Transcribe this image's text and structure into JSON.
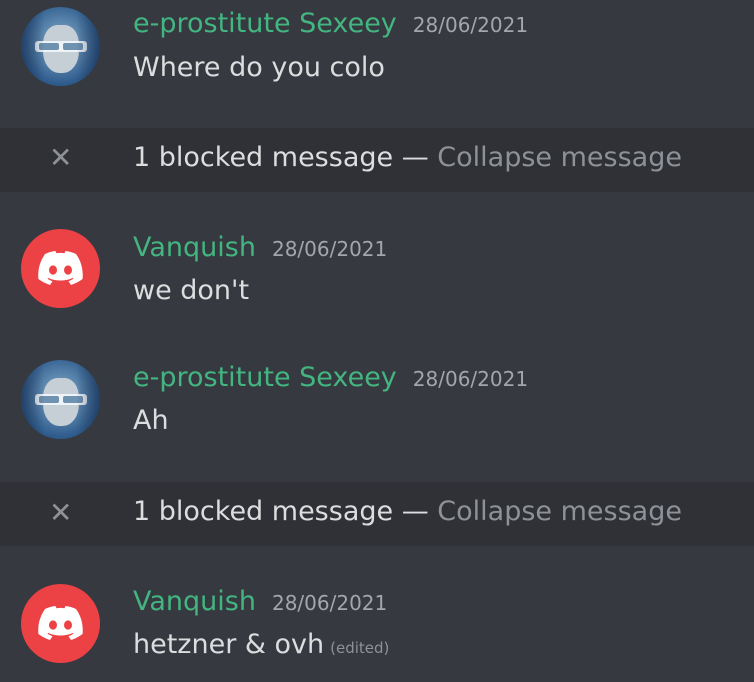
{
  "messages": [
    {
      "username": "e-prostitute Sexeey",
      "timestamp": "28/06/2021",
      "content": "Where do you colo"
    },
    {
      "username": "Vanquish",
      "timestamp": "28/06/2021",
      "content": "we don't"
    },
    {
      "username": "e-prostitute Sexeey",
      "timestamp": "28/06/2021",
      "content": "Ah"
    },
    {
      "username": "Vanquish",
      "timestamp": "28/06/2021",
      "content": "hetzner & ovh",
      "edited": "(edited)"
    }
  ],
  "blocked": [
    {
      "label": "1 blocked message",
      "separator": " — ",
      "action": "Collapse message",
      "icon": "close-icon"
    },
    {
      "label": "1 blocked message",
      "separator": " — ",
      "action": "Collapse message",
      "icon": "close-icon"
    }
  ],
  "colors": {
    "background": "#36393f",
    "blocked_background": "#2f3136",
    "username": "#43b581",
    "avatar_discord": "#ed4245"
  },
  "icons": {
    "photo_avatar": "user-photo-avatar",
    "discord_avatar": "discord-logo-icon"
  }
}
